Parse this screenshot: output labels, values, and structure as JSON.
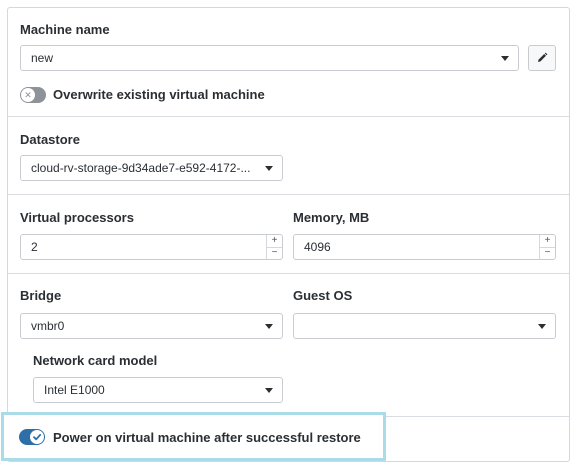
{
  "machine": {
    "label": "Machine name",
    "value": "new",
    "edit_icon": "pencil-icon"
  },
  "overwrite": {
    "label": "Overwrite existing virtual machine",
    "enabled": false
  },
  "datastore": {
    "label": "Datastore",
    "value": "cloud-rv-storage-9d34ade7-e592-4172-..."
  },
  "cpu": {
    "label": "Virtual processors",
    "value": "2"
  },
  "memory": {
    "label": "Memory, MB",
    "value": "4096"
  },
  "bridge": {
    "label": "Bridge",
    "value": "vmbr0"
  },
  "guest_os": {
    "label": "Guest OS",
    "value": ""
  },
  "nic": {
    "label": "Network card model",
    "value": "Intel E1000"
  },
  "power_on": {
    "label": "Power on virtual machine after successful restore",
    "enabled": true
  },
  "spinner": {
    "up": "+",
    "down": "−"
  },
  "colors": {
    "toggle_on": "#2f6fa8",
    "toggle_off": "#8e9399",
    "highlight": "#a9dbe8"
  }
}
